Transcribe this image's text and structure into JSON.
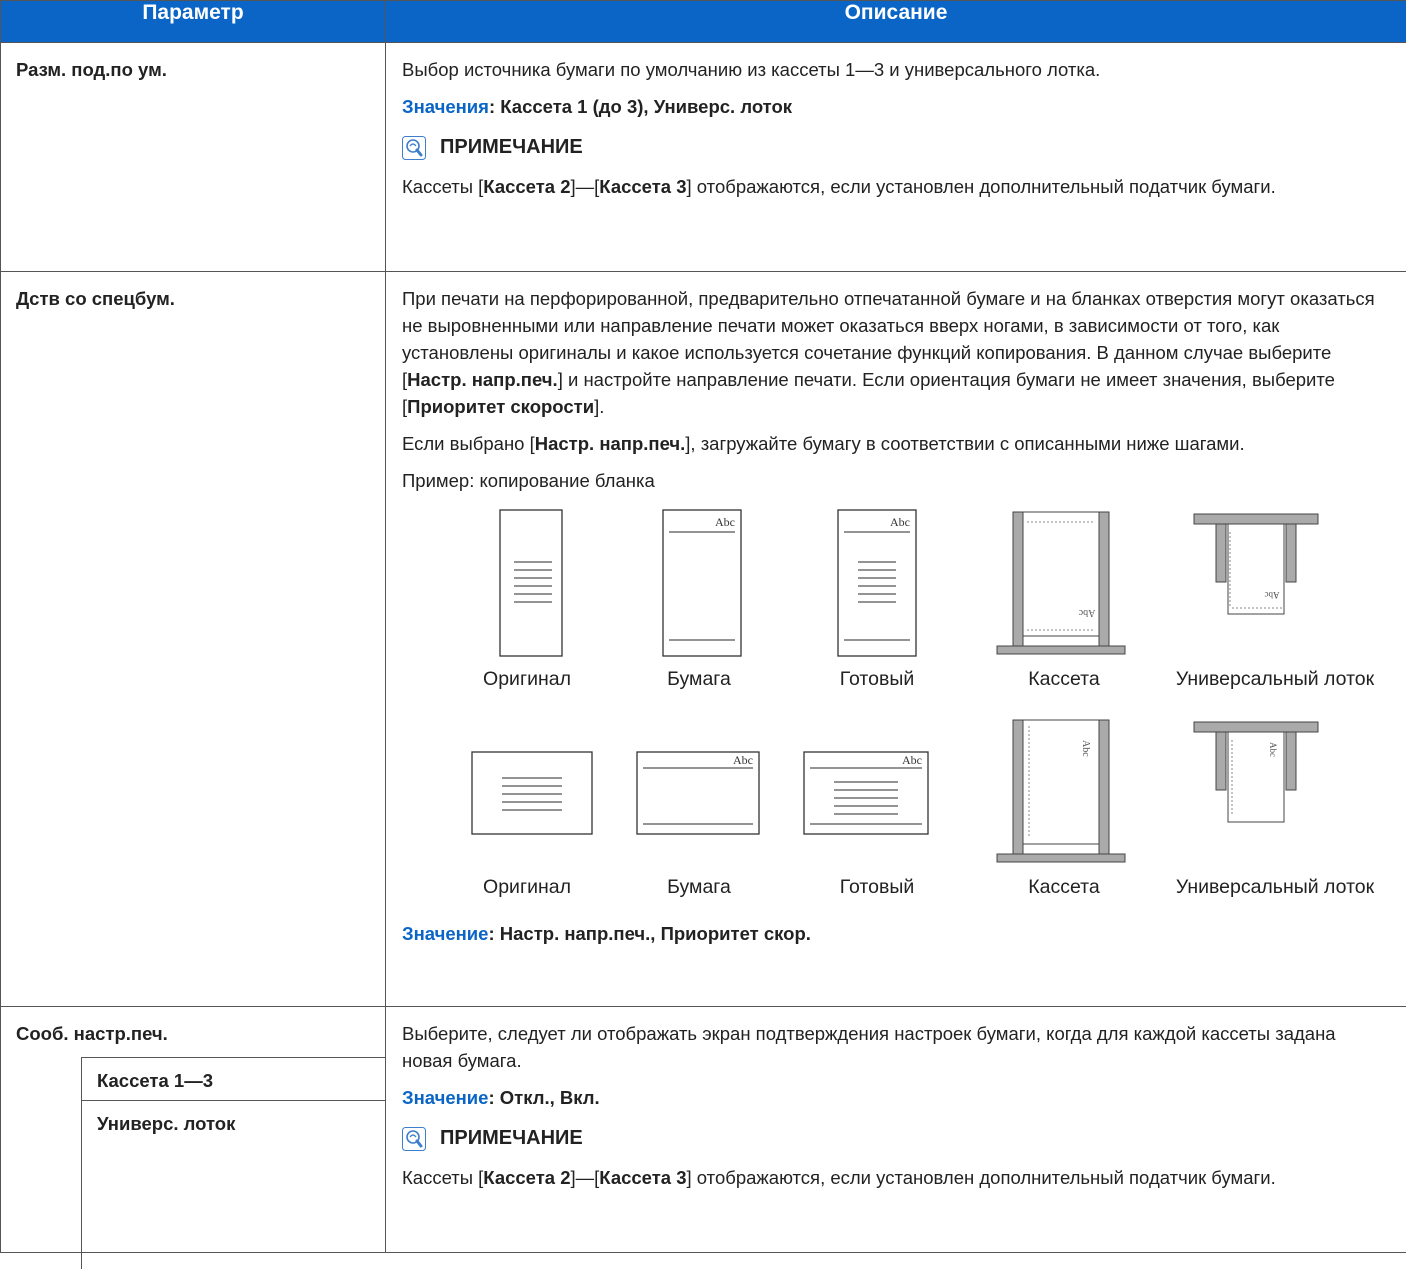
{
  "table": {
    "header_param": "Параметр",
    "header_desc": "Описание"
  },
  "row1": {
    "param": "Разм. под.по ум.",
    "desc": "Выбор источника бумаги по умолчанию из кассеты 1—3 и универсального лотка.",
    "values_label": "Значения",
    "values_text": ": Кассета 1 (до 3), Универс. лоток",
    "note_title": "ПРИМЕЧАНИЕ",
    "note_pre": "Кассеты [",
    "note_b1": "Кассета 2",
    "note_mid": "]—[",
    "note_b2": "Кассета 3",
    "note_post": "] отображаются, если установлен дополнительный податчик бумаги."
  },
  "row2": {
    "param": "Дств со спецбум.",
    "p1_a": "При печати на перфорированной, предварительно отпечатанной бумаге и на бланках отверстия могут оказаться не выровненными или направление печати может оказаться вверх ногами, в зависимости от того, как установлены оригиналы и какое используется сочетание функций копирования. В данном случае выберите [",
    "p1_b1": "Настр. напр.печ.",
    "p1_c": "] и настройте направление печати. Если ориентация бумаги не имеет значения, выберите [",
    "p1_b2": "Приоритет скорости",
    "p1_d": "].",
    "p2_a": "Если выбрано [",
    "p2_b": "Настр. напр.печ.",
    "p2_c": "], загружайте бумагу в соответствии с описанными ниже шагами.",
    "example": "Пример: копирование бланка",
    "captions": [
      "Оригинал",
      "Бумага",
      "Готовый",
      "Кассета",
      "Универсальный лоток"
    ],
    "paper_text": "Abc",
    "value_label": "Значение",
    "value_text": ": Настр.  напр.печ., Приоритет скор."
  },
  "row3": {
    "param": "Сооб. настр.печ.",
    "sub1": "Кассета 1—3",
    "sub2": "Универс. лоток",
    "desc": "Выберите, следует ли отображать экран подтверждения настроек бумаги, когда для каждой кассеты задана новая бумага.",
    "value_label": "Значение",
    "value_text": ": Откл., Вкл.",
    "note_title": "ПРИМЕЧАНИЕ",
    "note_pre": "Кассеты [",
    "note_b1": "Кассета 2",
    "note_mid": "]—[",
    "note_b2": "Кассета 3",
    "note_post": "] отображаются, если установлен дополнительный податчик бумаги."
  },
  "colors": {
    "header_bg": "#0a65c6",
    "value_label": "#0a65c6"
  },
  "icons": {
    "note": "lightbulb-note-icon"
  }
}
